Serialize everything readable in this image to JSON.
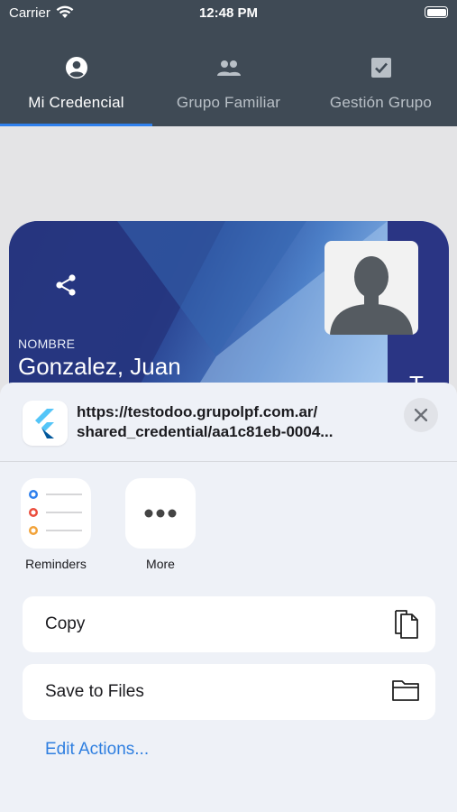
{
  "status_bar": {
    "carrier": "Carrier",
    "time": "12:48 PM"
  },
  "tabs": [
    {
      "label": "Mi Credencial",
      "icon": "person-circle-icon",
      "active": true
    },
    {
      "label": "Grupo Familiar",
      "icon": "group-icon",
      "active": false
    },
    {
      "label": "Gestión Grupo",
      "icon": "checkbox-icon",
      "active": false
    }
  ],
  "card": {
    "name_label": "NOMBRE",
    "name_value": "Gonzalez, Juan",
    "edge_letter": "T",
    "share_icon": "share-icon",
    "avatar_icon": "person-silhouette-icon"
  },
  "share_sheet": {
    "app_icon": "flutter-icon",
    "url_line1": "https://testodoo.grupolpf.com.ar/",
    "url_line2": "shared_credential/aa1c81eb-0004...",
    "close_icon": "close-icon",
    "apps": [
      {
        "label": "Reminders",
        "icon": "reminders-icon"
      },
      {
        "label": "More",
        "icon": "more-icon"
      }
    ],
    "actions": [
      {
        "label": "Copy",
        "icon": "copy-icon"
      },
      {
        "label": "Save to Files",
        "icon": "folder-icon"
      }
    ],
    "edit_actions": "Edit Actions..."
  },
  "colors": {
    "app_bar": "#3f4a55",
    "tab_indicator": "#2f80ed",
    "card_primary": "#2a3a86",
    "link_blue": "#2f7fe0"
  }
}
